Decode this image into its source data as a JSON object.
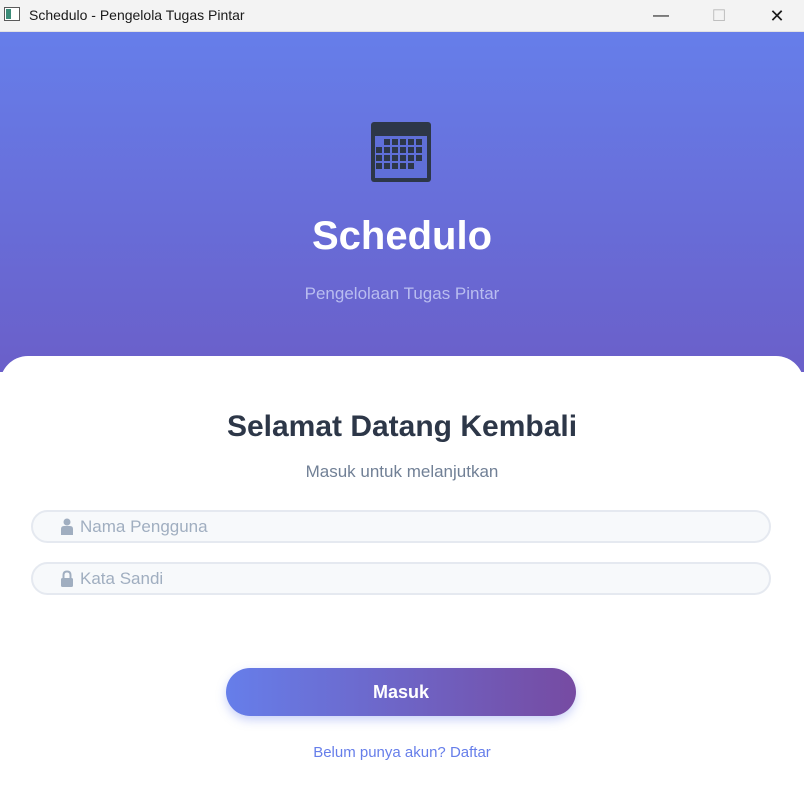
{
  "window": {
    "title": "Schedulo - Pengelola Tugas Pintar",
    "minimize_glyph": "—",
    "maximize_glyph": "☐",
    "close_glyph": "✕"
  },
  "hero": {
    "icon": "calendar-icon",
    "app_name": "Schedulo",
    "tagline": "Pengelolaan Tugas Pintar",
    "gradient_start": "#667eea",
    "gradient_end": "#6a5fc9"
  },
  "login": {
    "title": "Selamat Datang Kembali",
    "subtitle": "Masuk untuk melanjutkan",
    "username": {
      "icon": "user-icon",
      "placeholder": "Nama Pengguna",
      "value": ""
    },
    "password": {
      "icon": "lock-icon",
      "placeholder": "Kata Sandi",
      "value": ""
    },
    "submit_label": "Masuk",
    "button_gradient": [
      "#667eea",
      "#764ba2"
    ],
    "register_link": "Belum punya akun? Daftar"
  }
}
